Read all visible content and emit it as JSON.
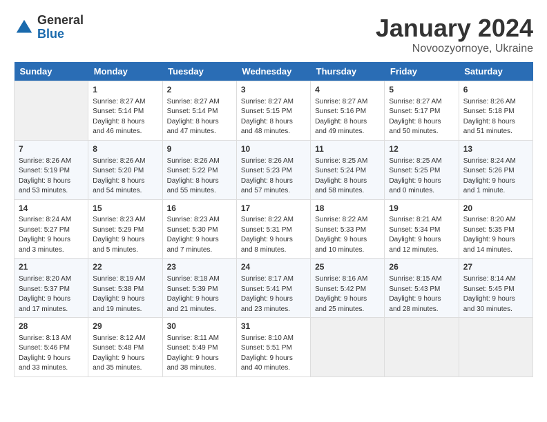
{
  "header": {
    "logo": {
      "general": "General",
      "blue": "Blue"
    },
    "title": "January 2024",
    "subtitle": "Novoozyornoye, Ukraine"
  },
  "days_of_week": [
    "Sunday",
    "Monday",
    "Tuesday",
    "Wednesday",
    "Thursday",
    "Friday",
    "Saturday"
  ],
  "weeks": [
    [
      {
        "day": "",
        "sunrise": "",
        "sunset": "",
        "daylight": "",
        "empty": true
      },
      {
        "day": "1",
        "sunrise": "Sunrise: 8:27 AM",
        "sunset": "Sunset: 5:14 PM",
        "daylight": "Daylight: 8 hours and 46 minutes."
      },
      {
        "day": "2",
        "sunrise": "Sunrise: 8:27 AM",
        "sunset": "Sunset: 5:14 PM",
        "daylight": "Daylight: 8 hours and 47 minutes."
      },
      {
        "day": "3",
        "sunrise": "Sunrise: 8:27 AM",
        "sunset": "Sunset: 5:15 PM",
        "daylight": "Daylight: 8 hours and 48 minutes."
      },
      {
        "day": "4",
        "sunrise": "Sunrise: 8:27 AM",
        "sunset": "Sunset: 5:16 PM",
        "daylight": "Daylight: 8 hours and 49 minutes."
      },
      {
        "day": "5",
        "sunrise": "Sunrise: 8:27 AM",
        "sunset": "Sunset: 5:17 PM",
        "daylight": "Daylight: 8 hours and 50 minutes."
      },
      {
        "day": "6",
        "sunrise": "Sunrise: 8:26 AM",
        "sunset": "Sunset: 5:18 PM",
        "daylight": "Daylight: 8 hours and 51 minutes."
      }
    ],
    [
      {
        "day": "7",
        "sunrise": "Sunrise: 8:26 AM",
        "sunset": "Sunset: 5:19 PM",
        "daylight": "Daylight: 8 hours and 53 minutes."
      },
      {
        "day": "8",
        "sunrise": "Sunrise: 8:26 AM",
        "sunset": "Sunset: 5:20 PM",
        "daylight": "Daylight: 8 hours and 54 minutes."
      },
      {
        "day": "9",
        "sunrise": "Sunrise: 8:26 AM",
        "sunset": "Sunset: 5:22 PM",
        "daylight": "Daylight: 8 hours and 55 minutes."
      },
      {
        "day": "10",
        "sunrise": "Sunrise: 8:26 AM",
        "sunset": "Sunset: 5:23 PM",
        "daylight": "Daylight: 8 hours and 57 minutes."
      },
      {
        "day": "11",
        "sunrise": "Sunrise: 8:25 AM",
        "sunset": "Sunset: 5:24 PM",
        "daylight": "Daylight: 8 hours and 58 minutes."
      },
      {
        "day": "12",
        "sunrise": "Sunrise: 8:25 AM",
        "sunset": "Sunset: 5:25 PM",
        "daylight": "Daylight: 9 hours and 0 minutes."
      },
      {
        "day": "13",
        "sunrise": "Sunrise: 8:24 AM",
        "sunset": "Sunset: 5:26 PM",
        "daylight": "Daylight: 9 hours and 1 minute."
      }
    ],
    [
      {
        "day": "14",
        "sunrise": "Sunrise: 8:24 AM",
        "sunset": "Sunset: 5:27 PM",
        "daylight": "Daylight: 9 hours and 3 minutes."
      },
      {
        "day": "15",
        "sunrise": "Sunrise: 8:23 AM",
        "sunset": "Sunset: 5:29 PM",
        "daylight": "Daylight: 9 hours and 5 minutes."
      },
      {
        "day": "16",
        "sunrise": "Sunrise: 8:23 AM",
        "sunset": "Sunset: 5:30 PM",
        "daylight": "Daylight: 9 hours and 7 minutes."
      },
      {
        "day": "17",
        "sunrise": "Sunrise: 8:22 AM",
        "sunset": "Sunset: 5:31 PM",
        "daylight": "Daylight: 9 hours and 8 minutes."
      },
      {
        "day": "18",
        "sunrise": "Sunrise: 8:22 AM",
        "sunset": "Sunset: 5:33 PM",
        "daylight": "Daylight: 9 hours and 10 minutes."
      },
      {
        "day": "19",
        "sunrise": "Sunrise: 8:21 AM",
        "sunset": "Sunset: 5:34 PM",
        "daylight": "Daylight: 9 hours and 12 minutes."
      },
      {
        "day": "20",
        "sunrise": "Sunrise: 8:20 AM",
        "sunset": "Sunset: 5:35 PM",
        "daylight": "Daylight: 9 hours and 14 minutes."
      }
    ],
    [
      {
        "day": "21",
        "sunrise": "Sunrise: 8:20 AM",
        "sunset": "Sunset: 5:37 PM",
        "daylight": "Daylight: 9 hours and 17 minutes."
      },
      {
        "day": "22",
        "sunrise": "Sunrise: 8:19 AM",
        "sunset": "Sunset: 5:38 PM",
        "daylight": "Daylight: 9 hours and 19 minutes."
      },
      {
        "day": "23",
        "sunrise": "Sunrise: 8:18 AM",
        "sunset": "Sunset: 5:39 PM",
        "daylight": "Daylight: 9 hours and 21 minutes."
      },
      {
        "day": "24",
        "sunrise": "Sunrise: 8:17 AM",
        "sunset": "Sunset: 5:41 PM",
        "daylight": "Daylight: 9 hours and 23 minutes."
      },
      {
        "day": "25",
        "sunrise": "Sunrise: 8:16 AM",
        "sunset": "Sunset: 5:42 PM",
        "daylight": "Daylight: 9 hours and 25 minutes."
      },
      {
        "day": "26",
        "sunrise": "Sunrise: 8:15 AM",
        "sunset": "Sunset: 5:43 PM",
        "daylight": "Daylight: 9 hours and 28 minutes."
      },
      {
        "day": "27",
        "sunrise": "Sunrise: 8:14 AM",
        "sunset": "Sunset: 5:45 PM",
        "daylight": "Daylight: 9 hours and 30 minutes."
      }
    ],
    [
      {
        "day": "28",
        "sunrise": "Sunrise: 8:13 AM",
        "sunset": "Sunset: 5:46 PM",
        "daylight": "Daylight: 9 hours and 33 minutes."
      },
      {
        "day": "29",
        "sunrise": "Sunrise: 8:12 AM",
        "sunset": "Sunset: 5:48 PM",
        "daylight": "Daylight: 9 hours and 35 minutes."
      },
      {
        "day": "30",
        "sunrise": "Sunrise: 8:11 AM",
        "sunset": "Sunset: 5:49 PM",
        "daylight": "Daylight: 9 hours and 38 minutes."
      },
      {
        "day": "31",
        "sunrise": "Sunrise: 8:10 AM",
        "sunset": "Sunset: 5:51 PM",
        "daylight": "Daylight: 9 hours and 40 minutes."
      },
      {
        "day": "",
        "sunrise": "",
        "sunset": "",
        "daylight": "",
        "empty": true
      },
      {
        "day": "",
        "sunrise": "",
        "sunset": "",
        "daylight": "",
        "empty": true
      },
      {
        "day": "",
        "sunrise": "",
        "sunset": "",
        "daylight": "",
        "empty": true
      }
    ]
  ]
}
